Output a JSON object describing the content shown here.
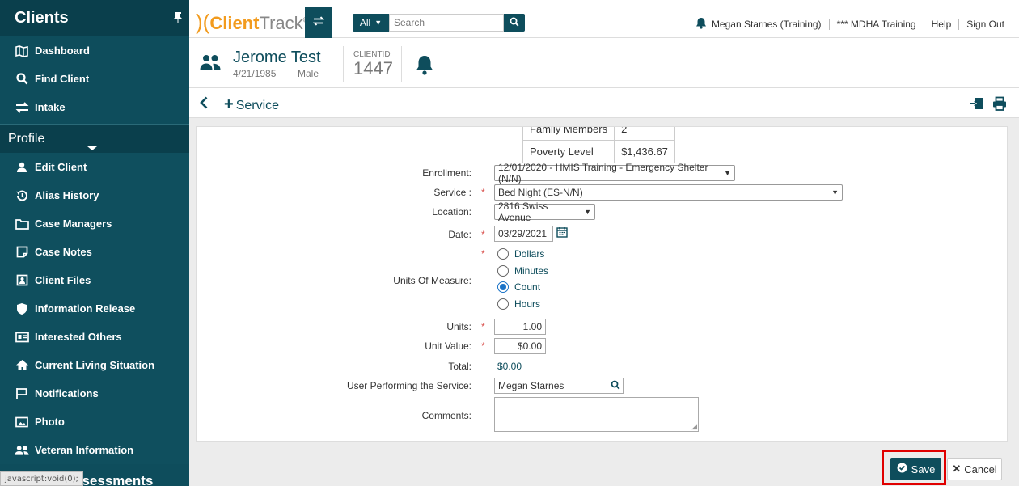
{
  "sidebar": {
    "title": "Clients",
    "top_items": [
      {
        "label": "Dashboard",
        "icon": "map-icon"
      },
      {
        "label": "Find Client",
        "icon": "search-icon"
      },
      {
        "label": "Intake",
        "icon": "exchange-icon"
      }
    ],
    "profile_label": "Profile",
    "profile_items": [
      {
        "label": "Edit Client",
        "icon": "user-icon"
      },
      {
        "label": "Alias History",
        "icon": "history-icon"
      },
      {
        "label": "Case Managers",
        "icon": "folder-icon"
      },
      {
        "label": "Case Notes",
        "icon": "note-icon"
      },
      {
        "label": "Client Files",
        "icon": "file-icon"
      },
      {
        "label": "Information Release",
        "icon": "shield-icon"
      },
      {
        "label": "Interested Others",
        "icon": "id-card-icon"
      },
      {
        "label": "Current Living Situation",
        "icon": "home-icon"
      },
      {
        "label": "Notifications",
        "icon": "flag-icon"
      },
      {
        "label": "Photo",
        "icon": "image-icon"
      },
      {
        "label": "Veteran Information",
        "icon": "users-icon"
      }
    ],
    "assessments_partial": "ssessments",
    "status_text": "javascript:void(0);"
  },
  "topbar": {
    "logo_client": "Client",
    "logo_track": "Track",
    "logo_reg": "®",
    "search_scope": "All",
    "search_placeholder": "Search",
    "user": "Megan Starnes (Training)",
    "org": "*** MDHA Training",
    "help": "Help",
    "signout": "Sign Out"
  },
  "client": {
    "name": "Jerome Test",
    "dob": "4/21/1985",
    "sex": "Male",
    "id_label": "CLIENTID",
    "id": "1447"
  },
  "page": {
    "title": "Service",
    "plus": "+"
  },
  "mini_table": [
    {
      "label": "Family Members",
      "value": "2"
    },
    {
      "label": "Poverty Level",
      "value": "$1,436.67"
    }
  ],
  "form": {
    "enrollment_label": "Enrollment:",
    "enrollment_value": "12/01/2020 - HMIS Training - Emergency Shelter (N/N)",
    "service_label": "Service :",
    "service_value": "Bed Night (ES-N/N)",
    "location_label": "Location:",
    "location_value": "2816 Swiss Avenue",
    "date_label": "Date:",
    "date_value": "03/29/2021",
    "uom_label": "Units Of Measure:",
    "uom_options": [
      "Dollars",
      "Minutes",
      "Count",
      "Hours"
    ],
    "uom_selected": "Count",
    "units_label": "Units:",
    "units_value": "1.00",
    "unit_value_label": "Unit Value:",
    "unit_value_value": "$0.00",
    "total_label": "Total:",
    "total_value": "$0.00",
    "user_label": "User Performing the Service:",
    "user_value": "Megan Starnes",
    "comments_label": "Comments:",
    "required_mark": "*"
  },
  "footer": {
    "save": "Save",
    "cancel": "Cancel"
  },
  "colors": {
    "brand": "#0e4d5c",
    "logo_orange": "#f29b1e",
    "required": "#d9534f",
    "highlight": "#e00000"
  }
}
